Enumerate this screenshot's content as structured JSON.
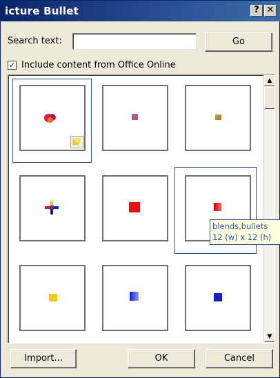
{
  "window": {
    "title": "icture Bullet",
    "help_glyph": "?",
    "close_glyph": "✕"
  },
  "search": {
    "label": "Search text:",
    "value": "",
    "go_label": "Go"
  },
  "include_online": {
    "checked": true,
    "check_glyph": "✓",
    "label": "Include content from Office Online"
  },
  "gallery": {
    "items": [
      {
        "name": "gallery-item-1",
        "bullet": "red-swirl-bullet",
        "selected": true
      },
      {
        "name": "gallery-item-2",
        "bullet": "purple-dot-bullet"
      },
      {
        "name": "gallery-item-3",
        "bullet": "tan-square-bullet"
      },
      {
        "name": "gallery-item-4",
        "bullet": "multicolor-star-bullet"
      },
      {
        "name": "gallery-item-5",
        "bullet": "red-square-bullet"
      },
      {
        "name": "gallery-item-6",
        "bullet": "red-gradient-square-bullet",
        "hovered": true
      },
      {
        "name": "gallery-item-7",
        "bullet": "yellow-square-bullet"
      },
      {
        "name": "gallery-item-8",
        "bullet": "blue-gradient-square-bullet"
      },
      {
        "name": "gallery-item-9",
        "bullet": "blue-square-bullet"
      }
    ]
  },
  "tooltip": {
    "line1": "blends,bullets",
    "line2": "12 (w) x 12 (h)"
  },
  "scrollbar": {
    "up_glyph": "▲",
    "down_glyph": "▼"
  },
  "footer": {
    "import_label": "Import...",
    "ok_label": "OK",
    "cancel_label": "Cancel"
  },
  "colors": {
    "title_bar": "#0a246a",
    "bullet_red": "#e21313",
    "bullet_blue": "#1020d0",
    "bullet_yellow": "#f0c818"
  }
}
